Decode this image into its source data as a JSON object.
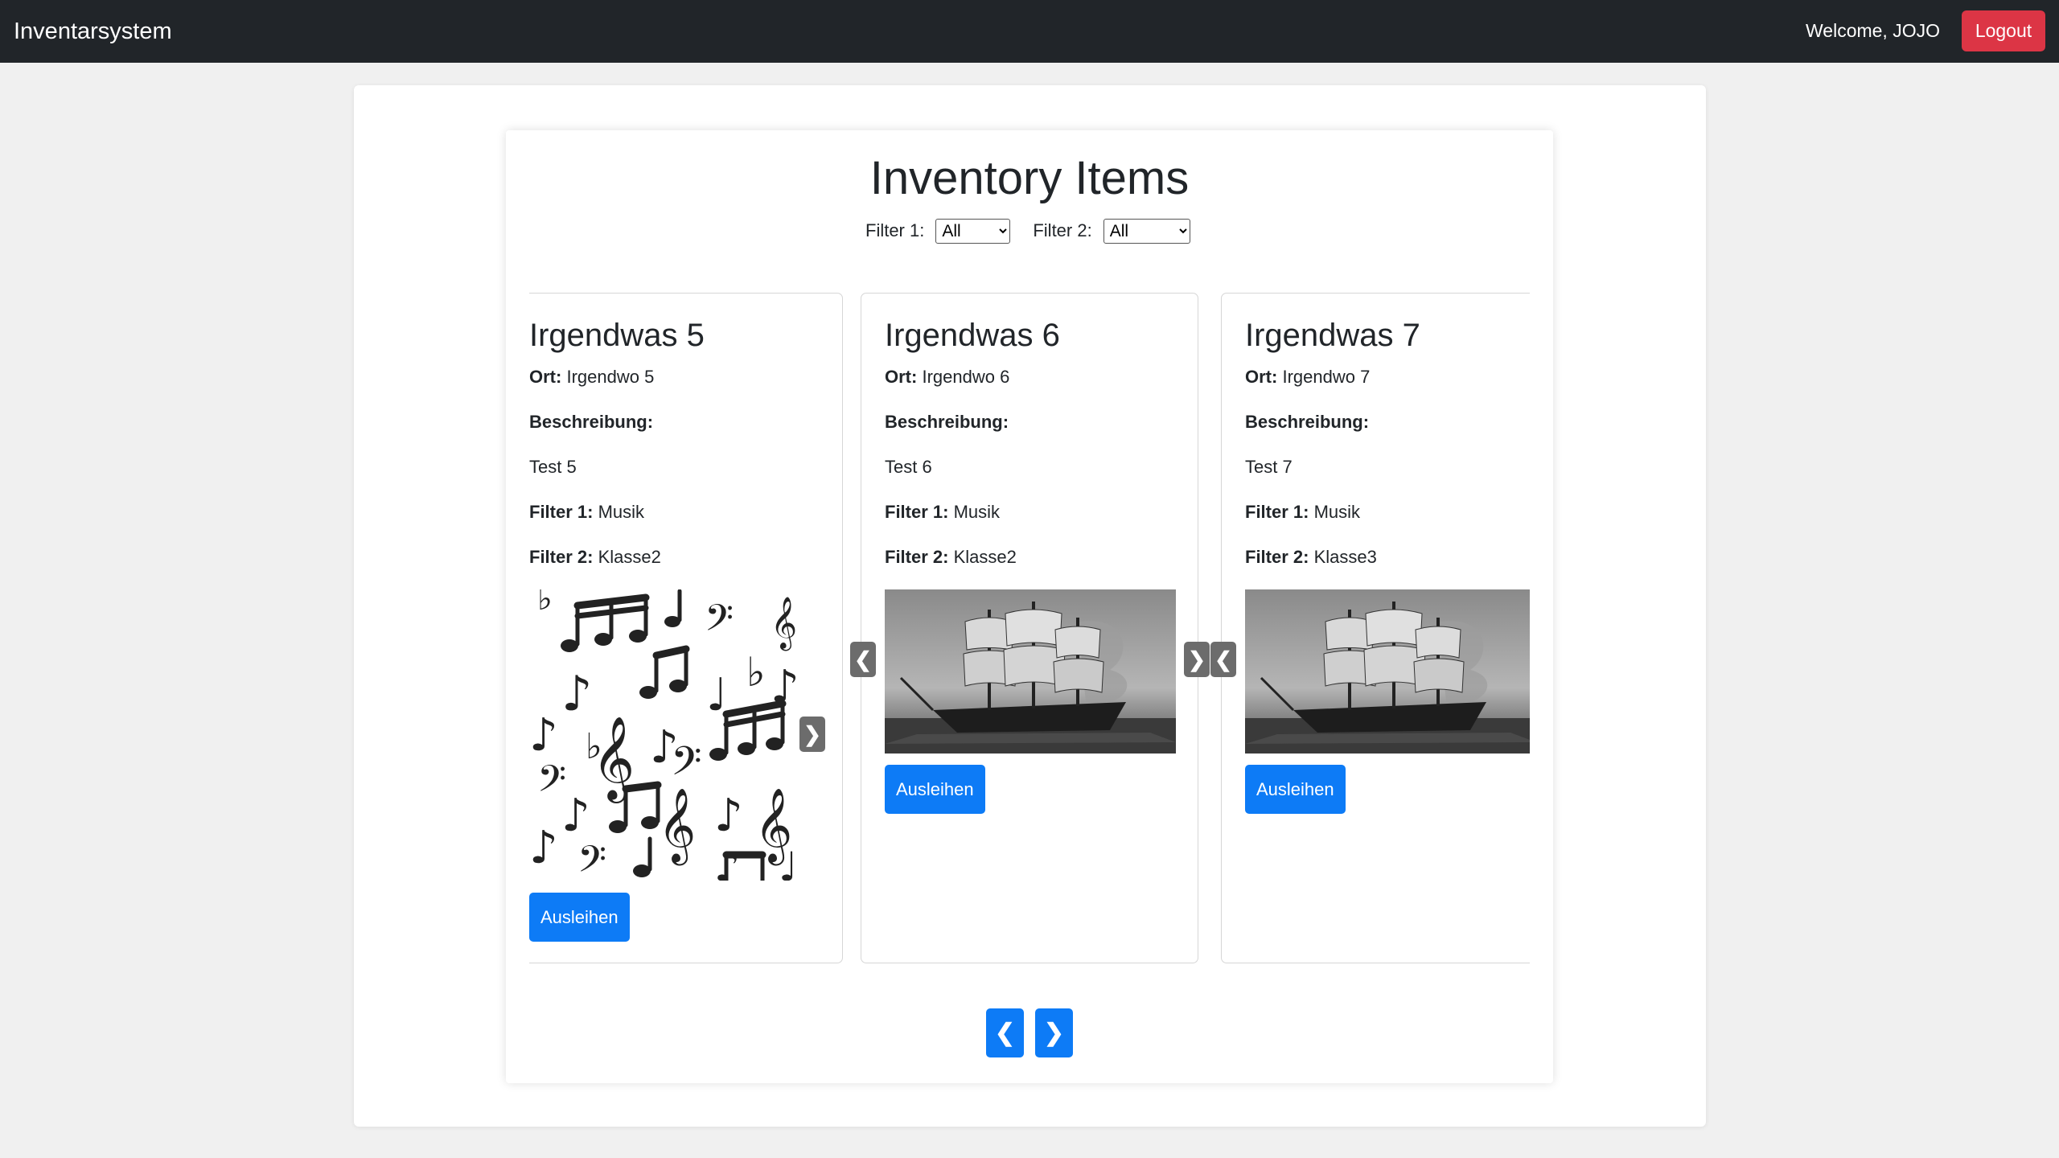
{
  "navbar": {
    "brand": "Inventarsystem",
    "welcome": "Welcome, JOJO",
    "logout_label": "Logout"
  },
  "page": {
    "title": "Inventory Items"
  },
  "filters": {
    "filter1_label": "Filter 1:",
    "filter1_value": "All",
    "filter2_label": "Filter 2:",
    "filter2_value": "All"
  },
  "labels": {
    "ort": "Ort:",
    "beschreibung": "Beschreibung:",
    "filter1": "Filter 1:",
    "filter2": "Filter 2:",
    "borrow": "Ausleihen"
  },
  "items": [
    {
      "title": "Irgendwas 5",
      "ort": "Irgendwo 5",
      "beschreibung": "Test 5",
      "filter1": "Musik",
      "filter2": "Klasse2",
      "image": "music-notes-image"
    },
    {
      "title": "Irgendwas 6",
      "ort": "Irgendwo 6",
      "beschreibung": "Test 6",
      "filter1": "Musik",
      "filter2": "Klasse2",
      "image": "ghost-ship-image"
    },
    {
      "title": "Irgendwas 7",
      "ort": "Irgendwo 7",
      "beschreibung": "Test 7",
      "filter1": "Musik",
      "filter2": "Klasse3",
      "image": "ghost-ship-image"
    }
  ],
  "image_arrows": {
    "prev": "❮",
    "next": "❯"
  },
  "pager": {
    "prev": "❮",
    "next": "❯"
  },
  "colors": {
    "navbar": "#212529",
    "logout": "#dc3545",
    "primary": "#0d7bf6",
    "image_arrow": "#6c6c6c"
  }
}
